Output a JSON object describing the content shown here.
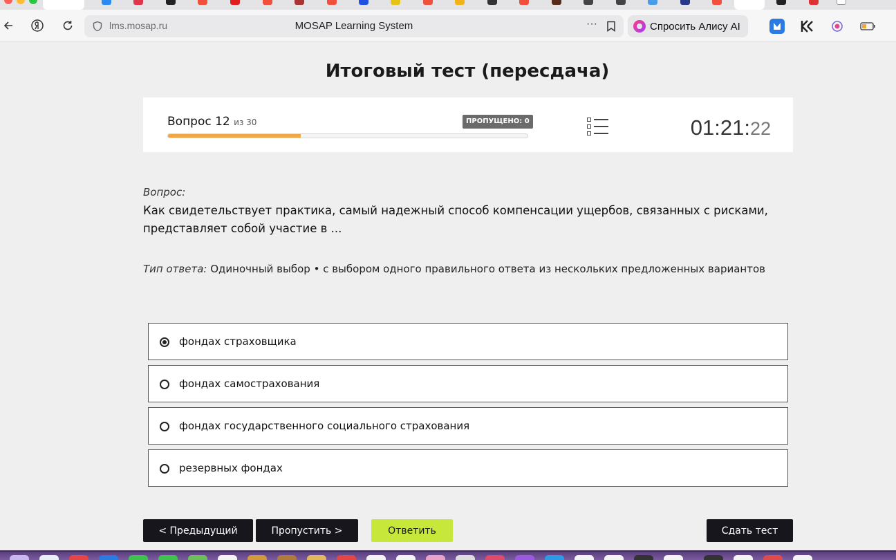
{
  "browser": {
    "url": "lms.mosap.ru",
    "tab_title": "MOSAP Learning System",
    "alice_label": "Спросить Алису AI",
    "more_glyph": "···"
  },
  "page": {
    "title": "Итоговый тест (пересдача)"
  },
  "status": {
    "question_label": "Вопрос 12",
    "question_of": "из 30",
    "skipped_label": "ПРОПУЩЕНО: 0",
    "progress": 0.37,
    "timer_main": "01:21:",
    "timer_seconds": "22"
  },
  "question": {
    "caption": "Вопрос:",
    "text": "Как свидетельствует практика, самый надежный способ компенсации ущербов, связанных с рисками, представляет собой участие в ...",
    "answer_type_caption": "Тип ответа:",
    "answer_type": " Одиночный выбор • с выбором одного правильного ответа из нескольких предложенных вариантов"
  },
  "options": [
    {
      "label": "фондах страховщика",
      "selected": true
    },
    {
      "label": "фондах самострахования",
      "selected": false
    },
    {
      "label": "фондах государственного социального страхования",
      "selected": false
    },
    {
      "label": "резервных фондах",
      "selected": false
    }
  ],
  "buttons": {
    "prev": "< Предыдущий",
    "skip": "Пропустить >",
    "answer": "Ответить",
    "submit": "Сдать тест"
  },
  "colors": {
    "progress": "#f0a641",
    "answer_button": "#c7e83a",
    "dark_button": "#16161c"
  }
}
